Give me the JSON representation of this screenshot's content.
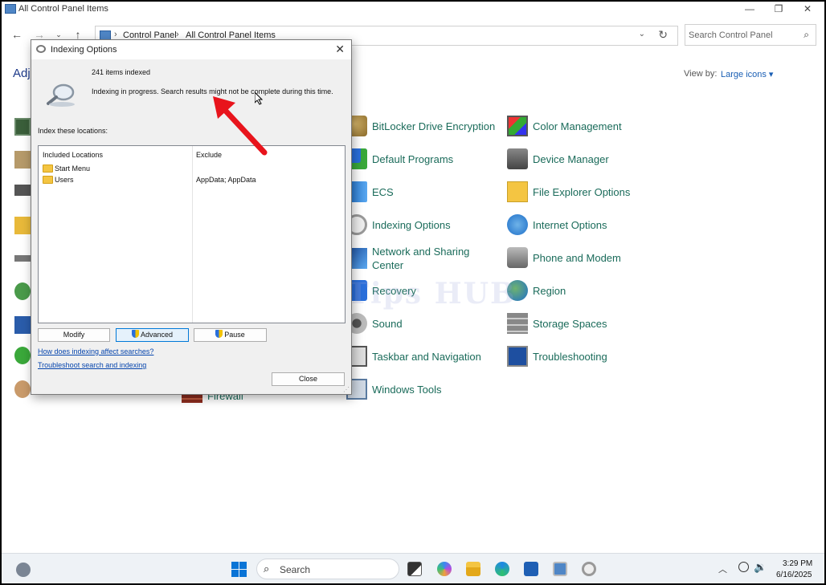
{
  "window": {
    "title": "All Control Panel Items",
    "minimize_icon": "minimize-icon",
    "maximize_icon": "maximize-icon",
    "close_icon": "close-icon"
  },
  "navbar": {
    "breadcrumbs": [
      "Control Panel",
      "All Control Panel Items"
    ],
    "search_placeholder": "Search Control Panel"
  },
  "header": {
    "adjust_label": "Adj",
    "view_by_label": "View by:",
    "view_by_value": "Large icons ▾"
  },
  "items": [
    {
      "label": "BitLocker Drive Encryption",
      "icon": "bitlocker-icon"
    },
    {
      "label": "Color Management",
      "icon": "color-management-icon"
    },
    {
      "label": "Default Programs",
      "icon": "default-programs-icon"
    },
    {
      "label": "Device Manager",
      "icon": "device-manager-icon"
    },
    {
      "label": "ECS",
      "icon": "ecs-icon"
    },
    {
      "label": "File Explorer Options",
      "icon": "file-explorer-options-icon"
    },
    {
      "label": "Indexing Options",
      "icon": "indexing-options-icon"
    },
    {
      "label": "Internet Options",
      "icon": "internet-options-icon"
    },
    {
      "label": "Network and Sharing Center",
      "icon": "network-icon"
    },
    {
      "label": "Phone and Modem",
      "icon": "phone-modem-icon"
    },
    {
      "label": "Recovery",
      "icon": "recovery-icon"
    },
    {
      "label": "Region",
      "icon": "region-icon"
    },
    {
      "label": "Sound",
      "icon": "sound-icon"
    },
    {
      "label": "Storage Spaces",
      "icon": "storage-spaces-icon"
    },
    {
      "label": "Taskbar and Navigation",
      "icon": "taskbar-icon"
    },
    {
      "label": "Troubleshooting",
      "icon": "troubleshooting-icon"
    },
    {
      "label": "Windows Tools",
      "icon": "windows-tools-icon"
    }
  ],
  "partial_item": {
    "label": "Firewall",
    "icon": "firewall-icon"
  },
  "dialog": {
    "title": "Indexing Options",
    "items_indexed": "241 items indexed",
    "status": "Indexing in progress. Search results might not be complete during this time.",
    "index_label": "Index these locations:",
    "columns": [
      "Included Locations",
      "Exclude"
    ],
    "locations": [
      {
        "name": "Start Menu",
        "exclude": ""
      },
      {
        "name": "Users",
        "exclude": "AppData; AppData"
      }
    ],
    "buttons": {
      "modify": "Modify",
      "advanced": "Advanced",
      "pause": "Pause",
      "close": "Close"
    },
    "links": [
      "How does indexing affect searches?",
      "Troubleshoot search and indexing"
    ]
  },
  "watermark": "IT Tips HUB",
  "taskbar": {
    "search_label": "Search",
    "time": "3:29 PM",
    "date": "6/16/2025",
    "apps": [
      "file-manager-icon",
      "copilot-icon",
      "file-explorer-icon",
      "edge-icon",
      "store-icon",
      "control-panel-icon",
      "indexing-options-icon"
    ]
  },
  "colors": {
    "link": "#1a6b5a",
    "accent": "#0078d7",
    "arrow": "#e8141c"
  }
}
